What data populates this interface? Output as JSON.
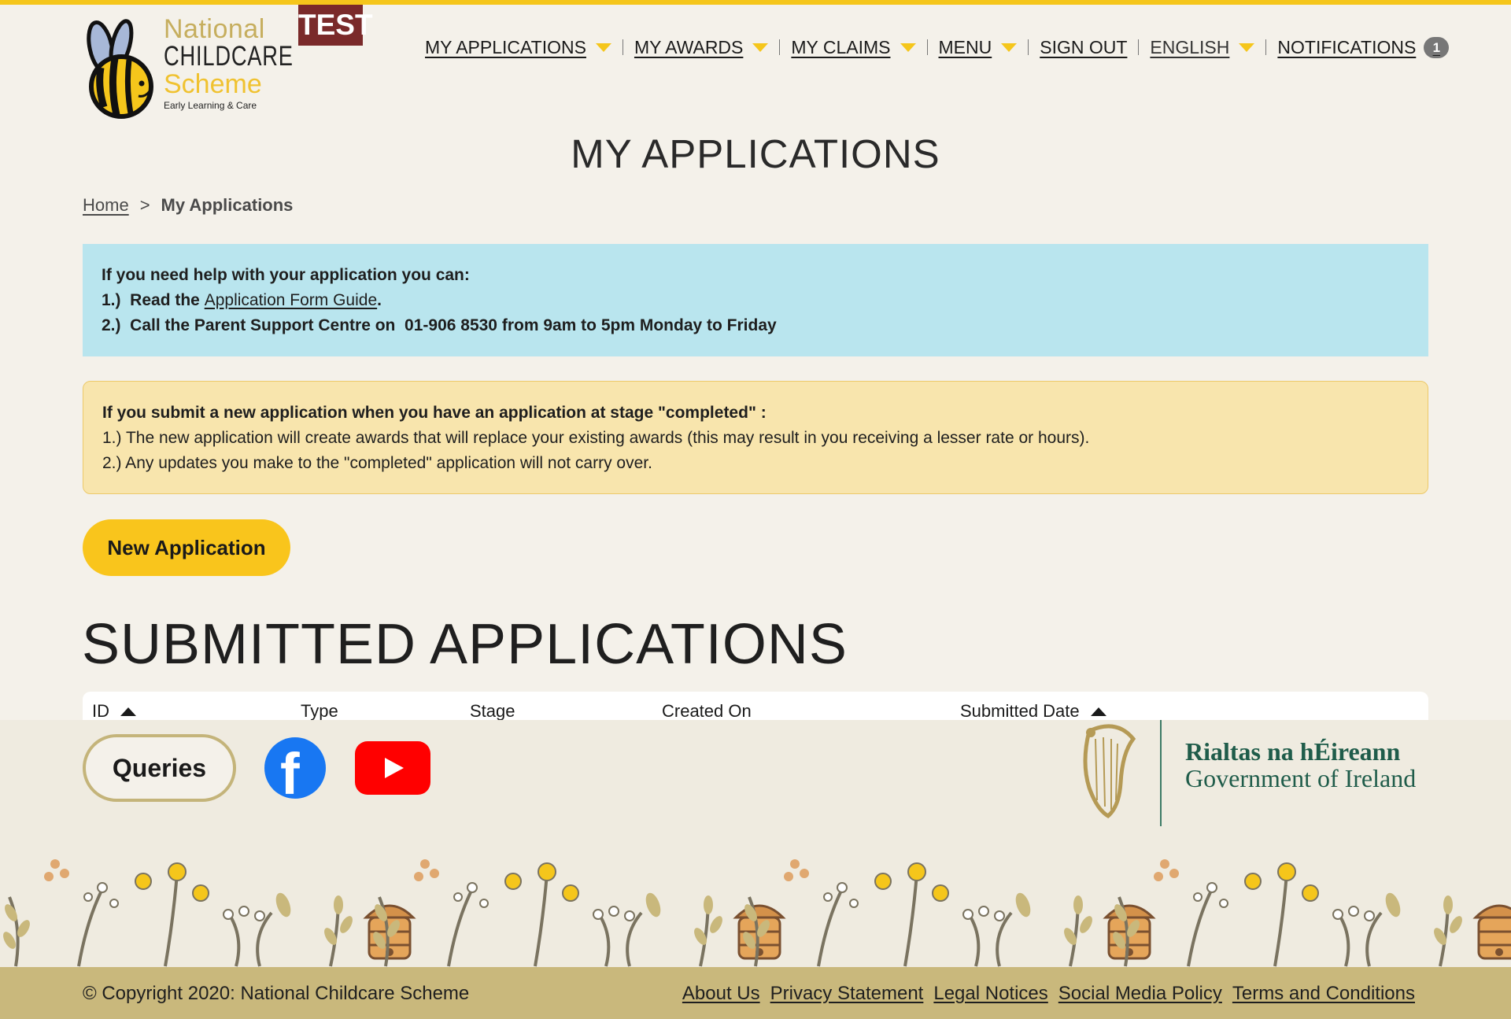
{
  "header": {
    "logo": {
      "line1": "National",
      "line2": "CHILDCARE",
      "line3": "Scheme",
      "line4": "Early Learning & Care"
    },
    "test_badge": "TEST",
    "nav": {
      "my_applications": "MY APPLICATIONS",
      "my_awards": "MY AWARDS",
      "my_claims": "MY CLAIMS",
      "menu": "MENU",
      "sign_out": "SIGN OUT",
      "language": "ENGLISH",
      "notifications": "NOTIFICATIONS",
      "notification_count": "1"
    }
  },
  "page_title": "MY APPLICATIONS",
  "breadcrumb": {
    "home": "Home",
    "separator": ">",
    "current": "My Applications"
  },
  "info_box": {
    "heading": "If you need help with your application you can:",
    "item1_prefix": "1.)  Read the ",
    "item1_link": "Application Form Guide",
    "item1_suffix": ".",
    "item2": "2.)  Call the Parent Support Centre on  01-906 8530 from 9am to 5pm Monday to Friday"
  },
  "warning_box": {
    "heading": "If you submit a new application when you have an application at stage \"completed\" :",
    "item1": "1.) The new application will create awards that will replace your existing awards (this may result in you receiving a lesser rate or hours).",
    "item2": "2.) Any updates you make to the \"completed\" application will not carry over."
  },
  "new_application_button": "New Application",
  "submitted_section": {
    "title": "SUBMITTED APPLICATIONS",
    "columns": [
      "ID",
      "Type",
      "Stage",
      "Created On",
      "Submitted Date"
    ]
  },
  "footer": {
    "queries_button": "Queries",
    "gov_line1": "Rialtas na hÉireann",
    "gov_line2": "Government of Ireland",
    "copyright": "© Copyright 2020: National Childcare Scheme",
    "links": [
      "About Us",
      "Privacy Statement",
      "Legal Notices",
      "Social Media Policy",
      "Terms and Conditions"
    ]
  },
  "colors": {
    "accent_yellow": "#f5c61b",
    "info_blue": "#b9e5ee",
    "warning_yellow": "#f8e5ad",
    "test_badge": "#7a2a2a",
    "gov_green": "#1f5c4a",
    "footer_bar": "#c9b87c"
  }
}
